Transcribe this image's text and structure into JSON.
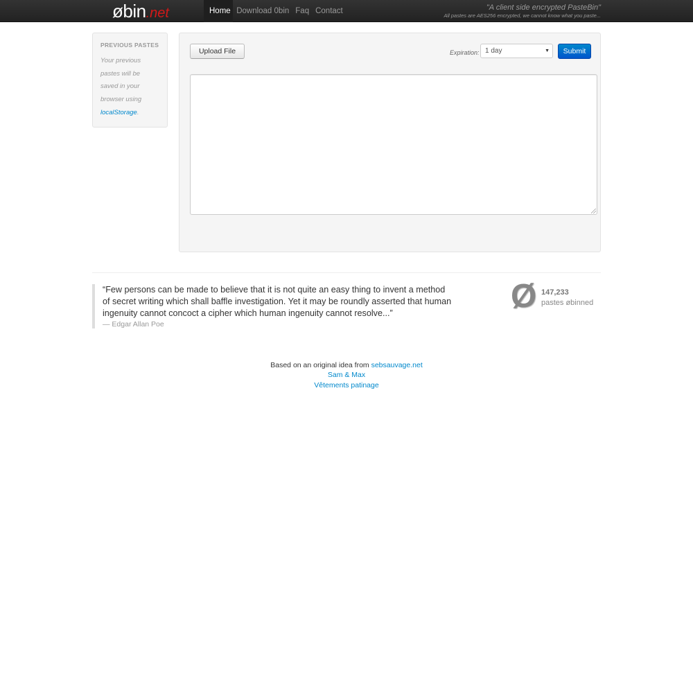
{
  "navbar": {
    "brand_main": "øbin",
    "brand_tld": ".net",
    "links": [
      "Home",
      "Download 0bin",
      "Faq",
      "Contact"
    ],
    "tagline": "\"A client side encrypted PasteBin\"",
    "tagline_sub": "All pastes are AES256 encrypted, we cannot know what you paste..."
  },
  "sidebar": {
    "title": "Previous pastes",
    "text": "Your previous pastes will be saved in your browser using",
    "link": "localStorage",
    "end": "."
  },
  "paste": {
    "upload_label": "Upload File",
    "expiration_label": "Expiration:",
    "expiration_value": "1 day",
    "submit_label": "Submit",
    "content": ""
  },
  "quote": {
    "text": "“Few persons can be made to believe that it is not quite an easy thing to invent a method of secret writing which shall baffle investigation. Yet it may be roundly asserted that human ingenuity cannot concoct a cipher which human ingenuity cannot resolve...”",
    "author": "— Edgar Allan Poe"
  },
  "counter": {
    "symbol": "Ø",
    "count": "147,233",
    "label": "pastes øbinned"
  },
  "footer": {
    "based_on": "Based on an original idea from",
    "based_link": "sebsauvage.net",
    "link2": "Sam & Max",
    "link3": "Vêtements patinage"
  },
  "colors": {
    "accent": "#0088cc",
    "brand_tld": "#d41818",
    "submit": "#0077cc"
  }
}
